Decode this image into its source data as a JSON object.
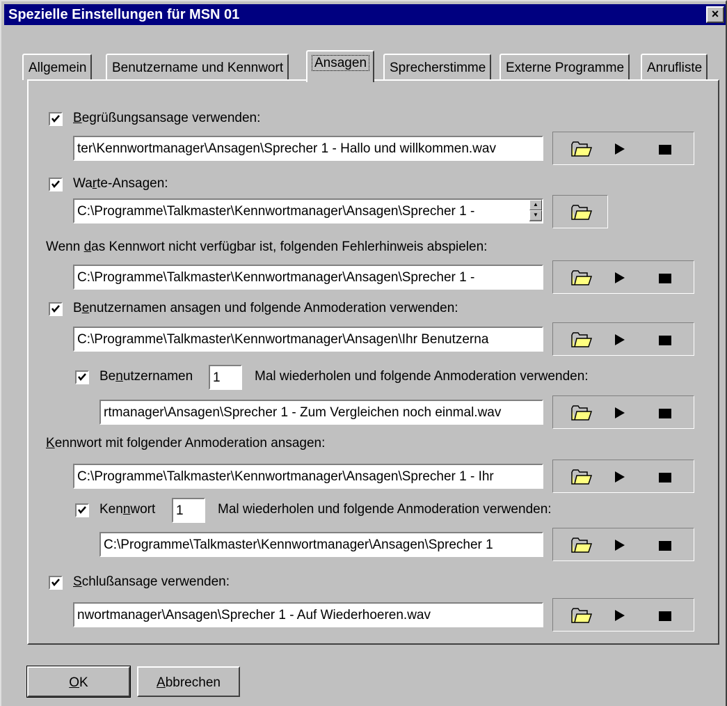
{
  "dialog": {
    "title": "Spezielle Einstellungen für MSN 01",
    "close_label": "×"
  },
  "tabs": [
    {
      "label": "Allgemein",
      "active": false
    },
    {
      "label": "Benutzername und Kennwort",
      "active": false
    },
    {
      "label": "Ansagen",
      "active": true
    },
    {
      "label": "Sprecherstimme",
      "active": false
    },
    {
      "label": "Externe Programme",
      "active": false
    },
    {
      "label": "Anrufliste",
      "active": false
    }
  ],
  "sections": {
    "greeting": {
      "label_pre": "",
      "label_key": "B",
      "label_post": "egrüßungsansage verwenden:",
      "checked": true,
      "value": "ter\\Kennwortmanager\\Ansagen\\Sprecher 1 - Hallo und willkommen.wav"
    },
    "waiting": {
      "label_pre": "Wa",
      "label_key": "r",
      "label_post": "te-Ansagen:",
      "checked": true,
      "value": "C:\\Programme\\Talkmaster\\Kennwortmanager\\Ansagen\\Sprecher 1 -"
    },
    "error": {
      "label_pre": "Wenn ",
      "label_key": "d",
      "label_post": "as Kennwort nicht verfügbar ist, folgenden Fehlerhinweis abspielen:",
      "value": "C:\\Programme\\Talkmaster\\Kennwortmanager\\Ansagen\\Sprecher 1 -"
    },
    "username": {
      "label_pre": "B",
      "label_key": "e",
      "label_post": "nutzernamen ansagen und folgende Anmoderation verwenden:",
      "checked": true,
      "value": "C:\\Programme\\Talkmaster\\Kennwortmanager\\Ansagen\\Ihr Benutzerna"
    },
    "username_repeat": {
      "label_pre": "Be",
      "label_key": "n",
      "label_post": "utzernamen",
      "checked": true,
      "count": "1",
      "suffix": "Mal wiederholen und folgende Anmoderation verwenden:",
      "value": "rtmanager\\Ansagen\\Sprecher 1 - Zum Vergleichen noch einmal.wav"
    },
    "password": {
      "label_pre": "",
      "label_key": "K",
      "label_post": "ennwort mit folgender Anmoderation ansagen:",
      "value": "C:\\Programme\\Talkmaster\\Kennwortmanager\\Ansagen\\Sprecher 1 - Ihr"
    },
    "password_repeat": {
      "label_pre": "Ken",
      "label_key": "n",
      "label_post": "wort",
      "checked": true,
      "count": "1",
      "suffix": "Mal wiederholen und folgende Anmoderation verwenden:",
      "value": "C:\\Programme\\Talkmaster\\Kennwortmanager\\Ansagen\\Sprecher 1"
    },
    "closing": {
      "label_pre": "",
      "label_key": "S",
      "label_post": "chlußansage verwenden:",
      "checked": true,
      "value": "nwortmanager\\Ansagen\\Sprecher 1 - Auf Wiederhoeren.wav"
    }
  },
  "buttons": {
    "ok_key": "O",
    "ok_rest": "K",
    "cancel_key": "A",
    "cancel_rest": "bbrechen"
  },
  "icons": [
    "folder-icon",
    "play-icon",
    "stop-icon"
  ],
  "colors": {
    "face": "#c0c0c0",
    "titlebar": "#000080",
    "folder": "#ffff80"
  }
}
